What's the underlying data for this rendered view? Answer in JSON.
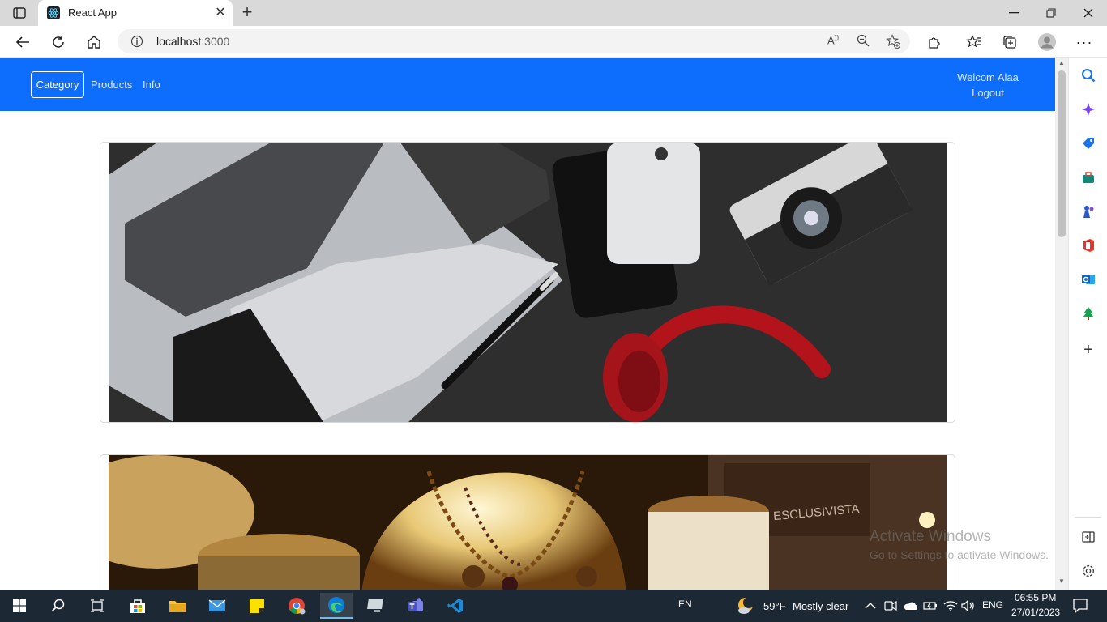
{
  "browser": {
    "tab_title": "React App",
    "url_host": "localhost",
    "url_port": ":3000",
    "icons": [
      "tab-actions-icon",
      "react-favicon-icon",
      "close-icon",
      "plus-icon",
      "minimize-icon",
      "restore-icon",
      "close-window-icon",
      "back-icon",
      "refresh-icon",
      "home-icon",
      "info-icon",
      "read-aloud-icon",
      "zoom-out-icon",
      "add-favorite-icon",
      "extensions-icon",
      "favorites-icon",
      "collections-icon",
      "profile-icon",
      "more-icon"
    ]
  },
  "navbar": {
    "links": [
      "Category",
      "Products",
      "Info"
    ],
    "welcome": "Welcom Alaa",
    "logout": "Logout",
    "color": "#0d6efd"
  },
  "cards": [
    {
      "image": "electronics-photo"
    },
    {
      "image": "jewelry-photo"
    }
  ],
  "watermark": {
    "line1": "Activate Windows",
    "line2": "Go to Settings to activate Windows."
  },
  "sidebar": {
    "icons": [
      "search-icon",
      "copilot-icon",
      "shopping-icon",
      "tools-icon",
      "games-icon",
      "office-icon",
      "outlook-icon",
      "tree-icon",
      "add-icon",
      "split-screen-icon",
      "settings-icon"
    ]
  },
  "taskbar": {
    "language_short": "EN",
    "weather": "59°F",
    "weather_text": "Mostly clear",
    "input_lang": "ENG",
    "time": "06:55 PM",
    "date": "27/01/2023"
  }
}
